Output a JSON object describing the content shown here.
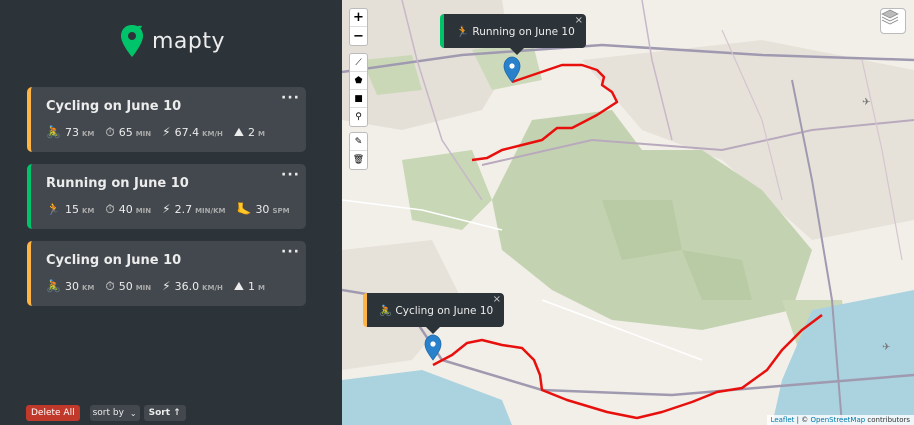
{
  "app": {
    "logo_text": "mapty"
  },
  "workouts": [
    {
      "type": "cycling",
      "title": "Cycling on June 10",
      "stats": [
        {
          "icon": "🚴",
          "value": "73",
          "unit": "km"
        },
        {
          "icon": "⏱",
          "value": "65",
          "unit": "min"
        },
        {
          "icon": "⚡",
          "value": "67.4",
          "unit": "km/h"
        },
        {
          "icon": "⛰",
          "value": "2",
          "unit": "m"
        }
      ]
    },
    {
      "type": "running",
      "title": "Running on June 10",
      "stats": [
        {
          "icon": "🏃",
          "value": "15",
          "unit": "km"
        },
        {
          "icon": "⏱",
          "value": "40",
          "unit": "min"
        },
        {
          "icon": "⚡",
          "value": "2.7",
          "unit": "min/km"
        },
        {
          "icon": "🦶",
          "value": "30",
          "unit": "spm"
        }
      ]
    },
    {
      "type": "cycling",
      "title": "Cycling on June 10",
      "stats": [
        {
          "icon": "🚴",
          "value": "30",
          "unit": "km"
        },
        {
          "icon": "⏱",
          "value": "50",
          "unit": "min"
        },
        {
          "icon": "⚡",
          "value": "36.0",
          "unit": "km/h"
        },
        {
          "icon": "⛰",
          "value": "1",
          "unit": "m"
        }
      ]
    }
  ],
  "workout_menu_label": "···",
  "controls": {
    "delete_all": "Delete All",
    "sort_by": "sort by",
    "sort_button": "Sort ↑"
  },
  "map": {
    "zoom_in": "+",
    "zoom_out": "−",
    "popups": {
      "running": {
        "icon": "🏃",
        "text": "Running on June 10",
        "close": "×"
      },
      "cycling": {
        "icon": "🚴",
        "text": "Cycling on June 10",
        "close": "×"
      }
    },
    "attribution": {
      "leaflet": "Leaflet",
      "separator": " | © ",
      "osm": "OpenStreetMap",
      "suffix": " contributors"
    },
    "colors": {
      "route": "#e8100d",
      "marker": "#2a81cb"
    }
  },
  "colors": {
    "sidebar_bg": "#2d3439",
    "card_bg": "#42484d",
    "cycling_accent": "#ffb545",
    "running_accent": "#00c46a",
    "brand_green": "#00c46a"
  }
}
